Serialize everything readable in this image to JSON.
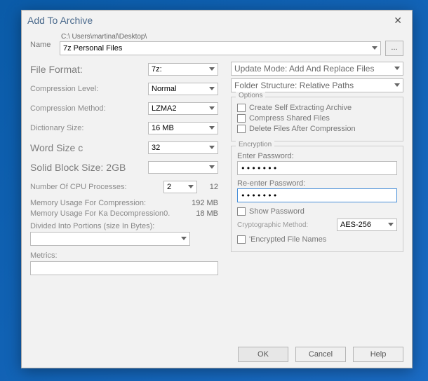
{
  "title": "Add To Archive",
  "name_label": "Name",
  "path": "C:\\ Users\\martinal\\Desktop\\",
  "filename": "7z Personal Files",
  "browse_label": "...",
  "left": {
    "file_format_label": "File Format:",
    "file_format_value": "7z:",
    "compression_level_label": "Compression Level:",
    "compression_level_value": "Normal",
    "compression_method_label": "Compression Method:",
    "compression_method_value": "LZMA2",
    "dictionary_size_label": "Dictionary Size:",
    "dictionary_size_value": "16 MB",
    "word_size_label": "Word Size c",
    "word_size_value": "32",
    "solid_block_label": "Solid Block Size:",
    "solid_block_value": "2GB",
    "cpu_label": "Number Of CPU Processes:",
    "cpu_value": "2",
    "cpu_tail": "12",
    "mem_comp_label": "Memory Usage For Compression:",
    "mem_comp_value": "192 MB",
    "mem_decomp_label": "Memory Usage For Ka Decompression0.",
    "mem_decomp_value": "18 MB",
    "divided_label": "Divided Into Portions (size In Bytes):",
    "divided_value": "",
    "metrics_label": "Metrics:",
    "metrics_value": ""
  },
  "right": {
    "update_mode_value": "Update Mode: Add And Replace Files",
    "folder_structure_value": "Folder Structure: Relative Paths",
    "options_title": "Options",
    "opt_self_extract": "Create Self Extracting Archive",
    "opt_compress_shared": "Compress Shared Files",
    "opt_delete_after": "Delete Files After Compression",
    "encryption_title": "Encryption",
    "enter_password_label": "Enter Password:",
    "enter_password_value": "•••••••",
    "reenter_password_label": "Re-enter Password:",
    "reenter_password_value": "•••••••",
    "show_password": "Show Password",
    "crypto_method_label": "Cryptographic Method:",
    "crypto_method_value": "AES-256",
    "encrypted_names": "'Encrypted File Names"
  },
  "buttons": {
    "ok": "OK",
    "cancel": "Cancel",
    "help": "Help"
  }
}
